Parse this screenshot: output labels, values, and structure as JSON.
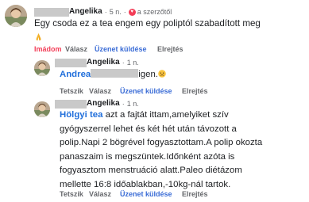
{
  "comment": {
    "author": "Angelika",
    "time": "5 n.",
    "badge": "a szerzőtől",
    "text": "Egy csoda ez a tea engem egy poliptól szabadított meg",
    "emoji": "pray-icon",
    "actions": {
      "like": "Imádom",
      "reply": "Válasz",
      "message": "Üzenet küldése",
      "hide": "Elrejtés"
    }
  },
  "replies": [
    {
      "author": "Angelika",
      "time": "1 n.",
      "mention": "Andrea",
      "text": "igen.",
      "emoji": "sad-face-icon",
      "actions": {
        "like": "Tetszik",
        "reply": "Válasz",
        "message": "Üzenet küldése",
        "hide": "Elrejtés"
      }
    },
    {
      "author": "Angelika",
      "time": "1 n.",
      "mention": "Hölgyi tea",
      "lines": [
        "azt a fajtát ittam,amelyiket szív",
        "gyógyszerrel lehet és két hét után távozott a",
        "polip.Napi 2 bögrével fogyasztottam.A polip okozta",
        "panaszaim is megszüntek.Időnként azóta is",
        "fogyasztom menstruáció alatt.Paleo diétázom",
        "mellette 16:8 időablakban,-10kg-nál tartok."
      ],
      "actions": {
        "like": "Tetszik",
        "reply": "Válasz",
        "message": "Üzenet küldése",
        "hide": "Elrejtés"
      }
    }
  ],
  "colors": {
    "liked": "#f33e58",
    "link": "#216fdb",
    "muted": "#65676b"
  }
}
